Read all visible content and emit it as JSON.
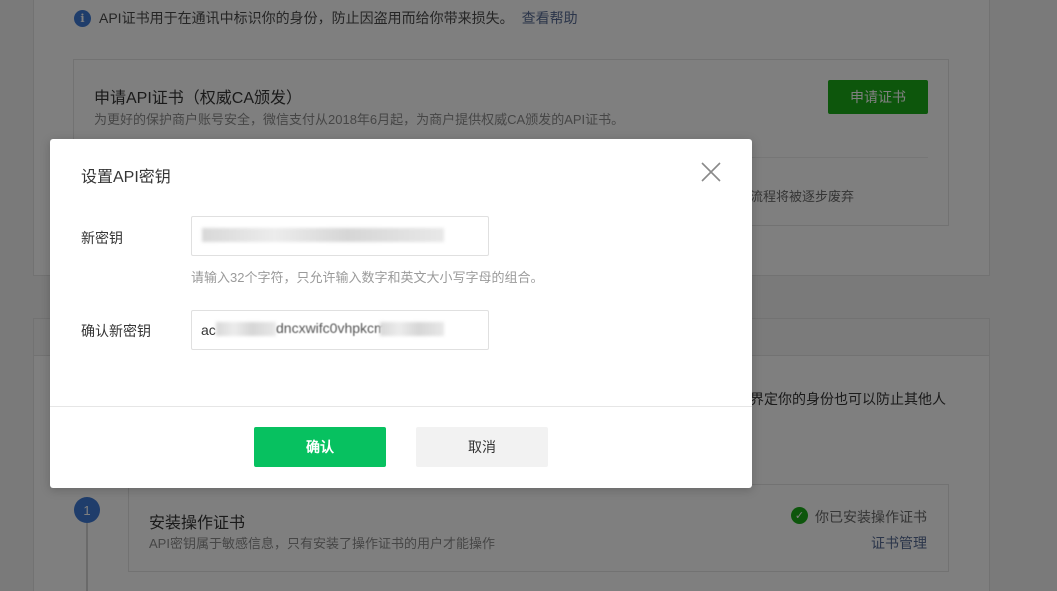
{
  "background": {
    "info_text": "API证书用于在通讯中标识你的身份，防止因盗用而给你带来损失。",
    "info_link": "查看帮助",
    "cert_card": {
      "title": "申请API证书（权威CA颁发）",
      "desc": "为更好的保护商户账号安全，微信支付从2018年6月起，为商户提供权威CA颁发的API证书。",
      "apply_button": "申请证书",
      "deprecated_text": "流程将被逐步废弃"
    },
    "key_section_text": "界定你的身份也可以防止其他人",
    "step": {
      "number": "1",
      "title": "安装操作证书",
      "desc": "API密钥属于敏感信息，只有安装了操作证书的用户才能操作",
      "status": "你已安装操作证书",
      "manage_link": "证书管理"
    }
  },
  "modal": {
    "title": "设置API密钥",
    "new_key_label": "新密钥",
    "new_key_value": "",
    "hint": "请输入32个字符，只允许输入数字和英文大小写字母的组合。",
    "confirm_key_label": "确认新密钥",
    "confirm_key_value": "ac",
    "confirm_key_visible_tail": "dncxwifc0vhpkcm",
    "confirm_button": "确认",
    "cancel_button": "取消"
  },
  "colors": {
    "primary_green": "#07c160",
    "wechat_green": "#1aad19",
    "link_blue": "#576b95",
    "info_blue": "#3e7ad6"
  }
}
